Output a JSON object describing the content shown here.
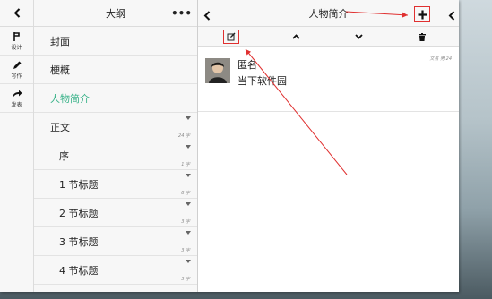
{
  "outline": {
    "title": "大纲",
    "more_label": "•••",
    "items": [
      {
        "label": "封面",
        "active": false,
        "indent": false,
        "caret": false,
        "count": ""
      },
      {
        "label": "梗概",
        "active": false,
        "indent": false,
        "caret": false,
        "count": ""
      },
      {
        "label": "人物简介",
        "active": true,
        "indent": false,
        "caret": false,
        "count": ""
      },
      {
        "label": "正文",
        "active": false,
        "indent": false,
        "caret": true,
        "count": "24 字"
      },
      {
        "label": "序",
        "active": false,
        "indent": true,
        "caret": true,
        "count": "1 字"
      },
      {
        "label": "1 节标题",
        "active": false,
        "indent": true,
        "caret": true,
        "count": "8 字"
      },
      {
        "label": "2 节标题",
        "active": false,
        "indent": true,
        "caret": true,
        "count": "3 字"
      },
      {
        "label": "3 节标题",
        "active": false,
        "indent": true,
        "caret": true,
        "count": "3 字"
      },
      {
        "label": "4 节标题",
        "active": false,
        "indent": true,
        "caret": true,
        "count": "3 字"
      }
    ]
  },
  "sidebar": {
    "tools": [
      {
        "label": "设计",
        "icon": "design-icon"
      },
      {
        "label": "写作",
        "icon": "pencil-icon"
      },
      {
        "label": "发表",
        "icon": "share-icon"
      }
    ]
  },
  "content": {
    "title": "人物简介",
    "character": {
      "name": "匿名",
      "description": "当下软件园",
      "meta": "文名 男 24"
    }
  },
  "colors": {
    "accent": "#3bb38a",
    "annotation": "#e03030"
  }
}
